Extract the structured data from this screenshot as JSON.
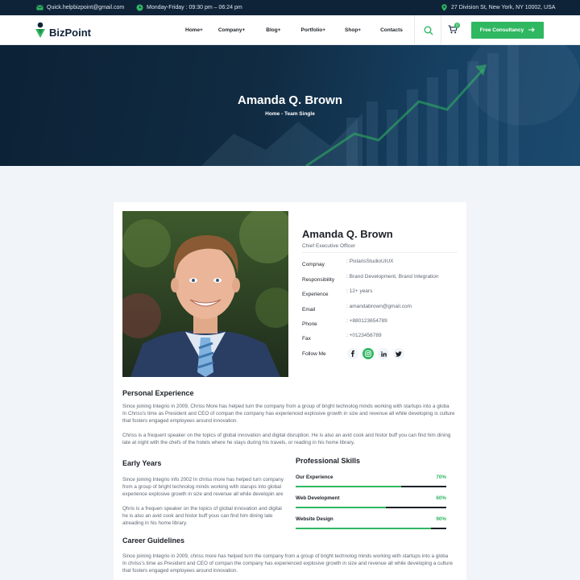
{
  "topbar": {
    "email": "Quick.helpbizpoint@gmail.com",
    "hours": "Monday-Friday : 09:30 pm – 06:24 pm",
    "address": "27 Division St, New York, NY 10002, USA"
  },
  "header": {
    "logo_text": "BizPoint",
    "nav": [
      {
        "label": "Home+"
      },
      {
        "label": "Company+"
      },
      {
        "label": "Blog+"
      },
      {
        "label": "Portfolio+"
      },
      {
        "label": "Shop+"
      },
      {
        "label": "Contacts"
      }
    ],
    "cart_count": "0",
    "cta_label": "Free Consultancy"
  },
  "hero": {
    "title": "Amanda Q. Brown",
    "breadcrumb": "Home - Team Single"
  },
  "profile": {
    "name": "Amanda Q. Brown",
    "role": "Chief Executive Officer",
    "info": [
      {
        "label": "Compnay",
        "value": ": PixlarisStudioUIUX"
      },
      {
        "label": "Responsibility",
        "value": ": Brand Development, Brand Integration"
      },
      {
        "label": "Experience",
        "value": ": 12+ years"
      },
      {
        "label": "Email",
        "value": ": amandabrown@gmail.com"
      },
      {
        "label": "Phone",
        "value": ": +880123654789"
      },
      {
        "label": "Fax",
        "value": ": +0123456789"
      }
    ],
    "follow_label": "Follow Me",
    "socials": [
      "facebook-icon",
      "instagram-icon",
      "linkedin-icon",
      "twitter-icon"
    ]
  },
  "personal_experience": {
    "title": "Personal Experience",
    "para1_lines": [
      "Since joining Integrio in 2009, Chriss More has helped turn the company from a group of bright technolog minds working with startups into a globa",
      "In Chriss's time as President and CEO of compan the company has experienced explosive growth in size and revenue all while developing is culture",
      "that fosters engaged employees around innovation."
    ],
    "para2_lines": [
      "Chriss is a frequent speaker on the topics of global innovation and digital disruption. He is also an avid cook and histor buff you can find him dining",
      "late at night with the chefs of the hotels where he stays during his travels, or reading in his home library."
    ]
  },
  "early_years": {
    "title": "Early Years",
    "para1_lines": [
      "Since joining Integrio info 2002 In chriss more has helped turn company",
      "from a group of bright technolog minds working with starups into global",
      "experience explosive growth in size and revenue all while developin are"
    ],
    "para2_lines": [
      "Qhris is a frequen speaker on the topics of global innovation and digital",
      "he is also an avid cook and histor buff yous can find him dining late",
      "atreading in his home library."
    ]
  },
  "skills": {
    "title": "Professional Skills",
    "items": [
      {
        "label": "Our Experience",
        "pct_text": "70%",
        "value": 0.7
      },
      {
        "label": "Web Development",
        "pct_text": "60%",
        "value": 0.6
      },
      {
        "label": "Website Design",
        "pct_text": "90%",
        "value": 0.9
      }
    ]
  },
  "career": {
    "title": "Career Guidelines",
    "para_lines": [
      "Since joining Integrio in 2009, chriss more has helped turn the company from a group of bright technolog minds working with startups into a globa",
      "In chriss's time as President and CEO of compan the company has experienced explosive growth in size and revenue all while developing a culture",
      "that fosters engaged employees around innovation."
    ]
  },
  "colors": {
    "accent": "#2fb761",
    "navy": "#0f2338"
  }
}
